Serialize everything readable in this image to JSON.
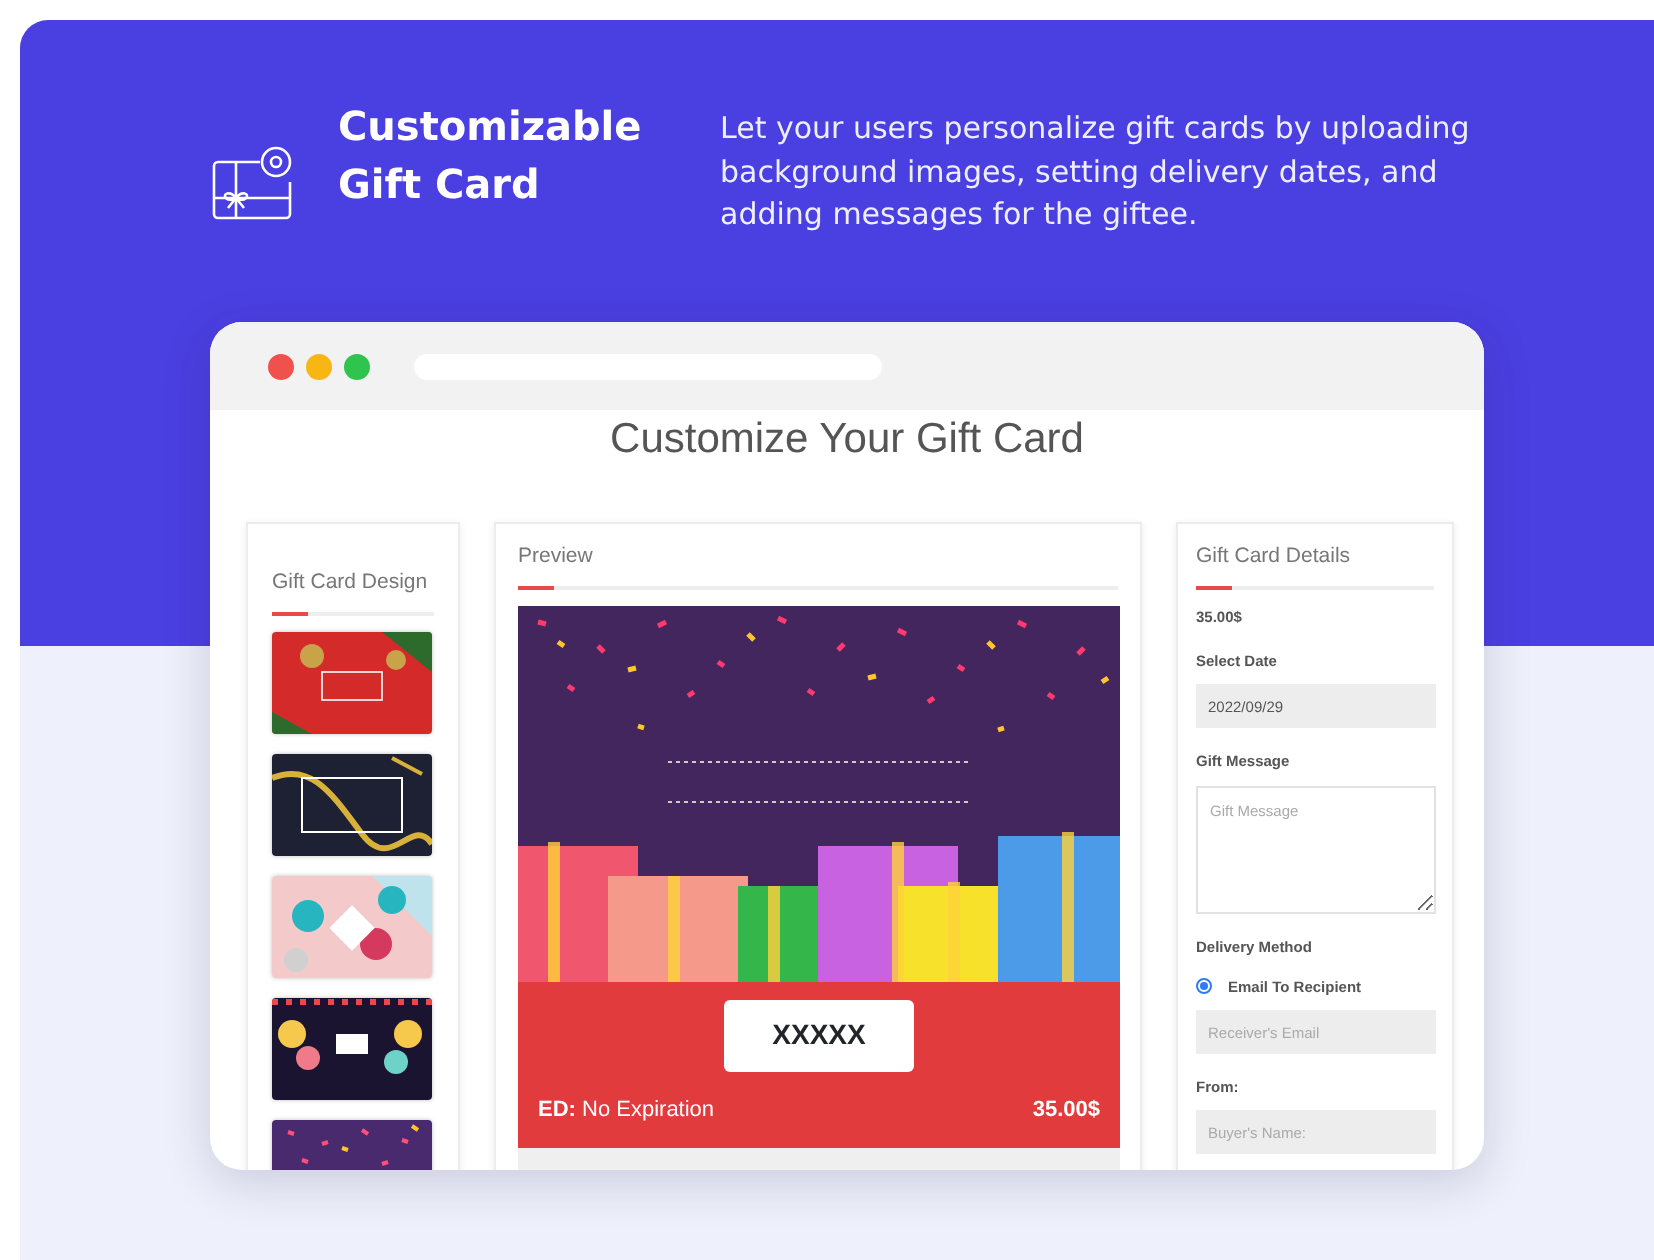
{
  "feature": {
    "title": "Customizable Gift Card",
    "description": "Let your users personalize gift cards by uploading background images, setting delivery dates, and adding messages for the giftee."
  },
  "browser": {
    "page_title": "Customize Your Gift Card"
  },
  "design_panel": {
    "title": "Gift Card Design"
  },
  "preview": {
    "title": "Preview",
    "code": "XXXXX",
    "expiry": "**ED:** No Expiration",
    "amount": "35.00$"
  },
  "details": {
    "title": "Gift Card Details",
    "items": [
      {
        "kind": "heading",
        "text": "35.00$"
      },
      {
        "kind": "heading",
        "text": "Select Date"
      },
      {
        "kind": "input",
        "value": "2022/09/29"
      },
      {
        "kind": "heading",
        "text": "Gift Message"
      },
      {
        "kind": "textarea",
        "placeholder": "Gift Message"
      },
      {
        "kind": "heading",
        "text": "Delivery Method"
      },
      {
        "kind": "radio",
        "label": "Email To Recipient",
        "selected": true
      },
      {
        "kind": "input",
        "placeholder": "Receiver's Email"
      },
      {
        "kind": "heading",
        "text": "From:"
      },
      {
        "kind": "input",
        "placeholder": "Buyer's Name:"
      }
    ]
  }
}
